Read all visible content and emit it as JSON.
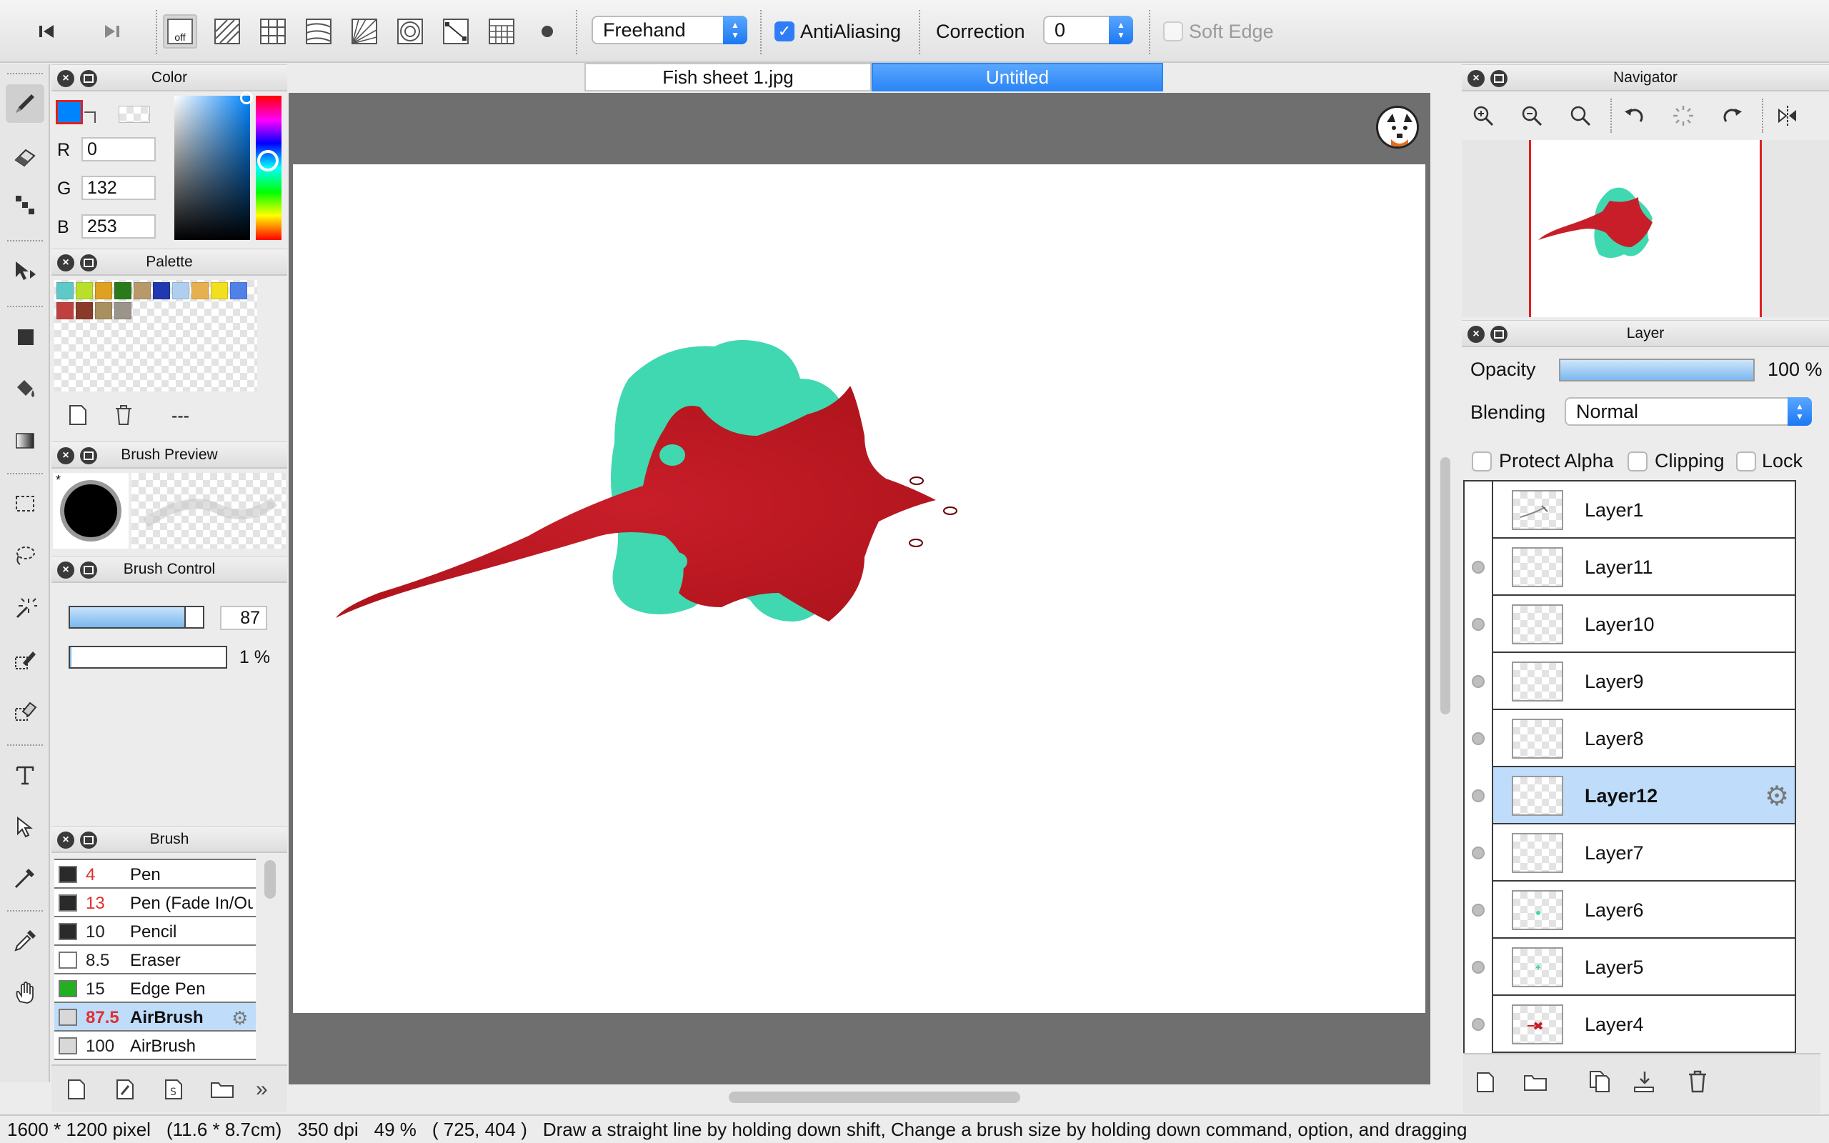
{
  "toolbar": {
    "stroke_mode": "Freehand",
    "antialiasing_label": "AntiAliasing",
    "antialiasing_checked": true,
    "correction_label": "Correction",
    "correction_value": "0",
    "soft_edge_label": "Soft Edge",
    "off_label": "off"
  },
  "color_panel": {
    "title": "Color",
    "r_label": "R",
    "r_value": "0",
    "g_label": "G",
    "g_value": "132",
    "b_label": "B",
    "b_value": "253",
    "primary_color": "#0084fd"
  },
  "palette_panel": {
    "title": "Palette",
    "swatches": [
      "#5fc8c8",
      "#b8e02a",
      "#e0a020",
      "#2a7a1a",
      "#b89a6a",
      "#2038b0",
      "#b0cff0",
      "#e6b050",
      "#f0e020",
      "#5080e8",
      "#c04040",
      "#8a3a28",
      "#a89060",
      "#9a948a"
    ],
    "name": "---"
  },
  "brush_preview_panel": {
    "title": "Brush Preview"
  },
  "brush_control_panel": {
    "title": "Brush Control",
    "size_value": "87",
    "size_fraction": 0.87,
    "density_value": "1 %",
    "density_fraction": 0.01
  },
  "brush_panel": {
    "title": "Brush",
    "items": [
      {
        "color": "#2a2a2a",
        "size": "4",
        "size_red": true,
        "name": "Pen"
      },
      {
        "color": "#2a2a2a",
        "size": "13",
        "size_red": true,
        "name": "Pen (Fade In/Out)"
      },
      {
        "color": "#2a2a2a",
        "size": "10",
        "size_red": false,
        "name": "Pencil"
      },
      {
        "color": "#ffffff",
        "size": "8.5",
        "size_red": false,
        "name": "Eraser"
      },
      {
        "color": "#22b022",
        "size": "15",
        "size_red": false,
        "name": "Edge Pen"
      },
      {
        "color": "#d8d8d8",
        "size": "87.5",
        "size_red": true,
        "name": "AirBrush",
        "selected": true
      },
      {
        "color": "#d8d8d8",
        "size": "100",
        "size_red": false,
        "name": "AirBrush"
      }
    ]
  },
  "document": {
    "tabs": [
      {
        "label": "Fish sheet 1.jpg",
        "active": false
      },
      {
        "label": "Untitled",
        "active": true
      }
    ]
  },
  "navigator_panel": {
    "title": "Navigator"
  },
  "layer_panel": {
    "title": "Layer",
    "opacity_label": "Opacity",
    "opacity_value": "100 %",
    "opacity_fraction": 1.0,
    "blending_label": "Blending",
    "blending_value": "Normal",
    "protect_alpha_label": "Protect Alpha",
    "clipping_label": "Clipping",
    "lock_label": "Lock",
    "layers": [
      {
        "name": "Layer1",
        "visible": false,
        "selected": false
      },
      {
        "name": "Layer11",
        "visible": true,
        "selected": false
      },
      {
        "name": "Layer10",
        "visible": true,
        "selected": false
      },
      {
        "name": "Layer9",
        "visible": true,
        "selected": false
      },
      {
        "name": "Layer8",
        "visible": true,
        "selected": false
      },
      {
        "name": "Layer12",
        "visible": true,
        "selected": true
      },
      {
        "name": "Layer7",
        "visible": true,
        "selected": false
      },
      {
        "name": "Layer6",
        "visible": true,
        "selected": false
      },
      {
        "name": "Layer5",
        "visible": true,
        "selected": false
      },
      {
        "name": "Layer4",
        "visible": true,
        "selected": false
      }
    ]
  },
  "status_bar": {
    "size": "1600 * 1200 pixel",
    "physical": "(11.6 * 8.7cm)",
    "dpi": "350 dpi",
    "zoom": "49 %",
    "cursor": "( 725, 404 )",
    "hint": "Draw a straight line by holding down shift, Change a brush size by holding down command, option, and dragging"
  },
  "colors": {
    "accent": "#2f7cf6",
    "ray_red": "#c8202a",
    "ray_teal": "#40d8b0"
  }
}
